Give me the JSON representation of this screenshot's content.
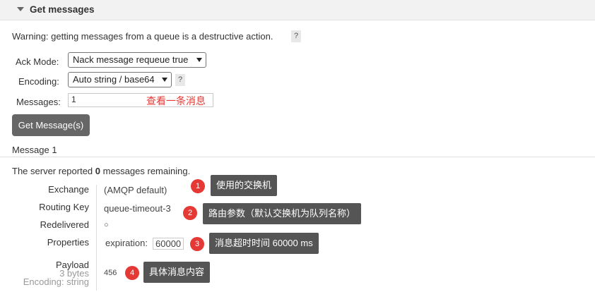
{
  "section": {
    "title": "Get messages"
  },
  "warning": {
    "text": "Warning: getting messages from a queue is a destructive action.",
    "help": "?"
  },
  "form": {
    "ack_label": "Ack Mode:",
    "ack_value": "Nack message requeue true",
    "encoding_label": "Encoding:",
    "encoding_value": "Auto string / base64",
    "encoding_help": "?",
    "messages_label": "Messages:",
    "messages_value": "1",
    "messages_note": "查看一条消息",
    "get_button": "Get Message(s)"
  },
  "message": {
    "header": "Message 1",
    "server_prefix": "The server reported ",
    "server_count": "0",
    "server_suffix": " messages remaining.",
    "props": {
      "exchange_label": "Exchange",
      "exchange_value": "(AMQP default)",
      "routing_label": "Routing Key",
      "routing_value": "queue-timeout-3",
      "redelivered_label": "Redelivered",
      "redelivered_value": "○",
      "properties_label": "Properties",
      "expiration_key": "expiration:",
      "expiration_value": "60000",
      "payload_label": "Payload",
      "payload_bytes": "3 bytes",
      "payload_encoding": "Encoding: string",
      "payload_value": "456"
    }
  },
  "annotations": [
    {
      "num": "1",
      "text": "使用的交换机"
    },
    {
      "num": "2",
      "text": "路由参数（默认交换机为队列名称）"
    },
    {
      "num": "3",
      "text": "消息超时时间 60000 ms"
    },
    {
      "num": "4",
      "text": "具体消息内容"
    }
  ],
  "colors": {
    "accent_red": "#e53935",
    "button_bg": "#666666",
    "callout_bg": "#555555"
  }
}
